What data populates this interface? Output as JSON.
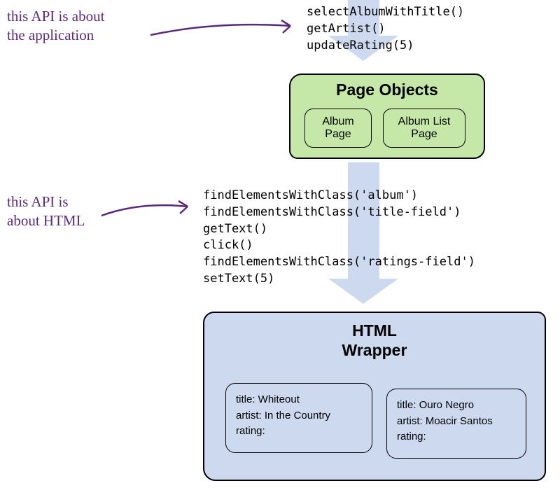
{
  "annotations": {
    "top": "this API is about\nthe application",
    "middle": "this API is\nabout HTML"
  },
  "api_app": [
    "selectAlbumWithTitle()",
    "getArtist()",
    "updateRating(5)"
  ],
  "api_html": [
    "findElementsWithClass('album')",
    "findElementsWithClass('title-field')",
    "getText()",
    "click()",
    "findElementsWithClass('ratings-field')",
    "setText(5)"
  ],
  "page_objects": {
    "title": "Page Objects",
    "items": [
      "Album\nPage",
      "Album List\nPage"
    ]
  },
  "html_wrapper": {
    "title": "HTML\nWrapper",
    "items": [
      "title: Whiteout\nartist: In the Country\nrating:",
      "title: Ouro Negro\nartist: Moacir Santos\nrating:"
    ]
  }
}
